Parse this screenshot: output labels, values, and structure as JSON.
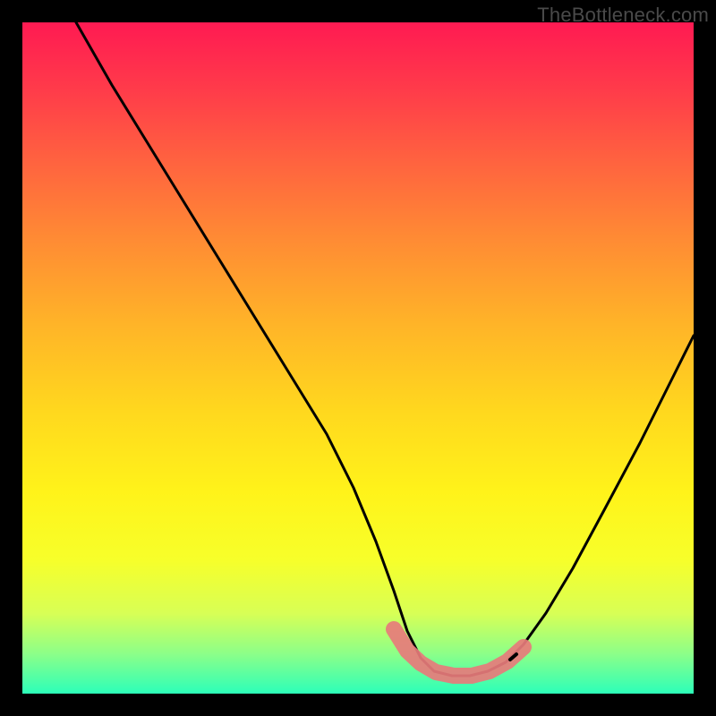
{
  "watermark": "TheBottleneck.com",
  "chart_data": {
    "type": "line",
    "title": "",
    "xlabel": "",
    "ylabel": "",
    "xlim": [
      0,
      100
    ],
    "ylim": [
      0,
      100
    ],
    "series": [
      {
        "name": "bottleneck-curve",
        "x": [
          0,
          5,
          10,
          15,
          20,
          25,
          30,
          35,
          40,
          45,
          50,
          54,
          57,
          60,
          63,
          66,
          70,
          74,
          78,
          82,
          86,
          90,
          95,
          100
        ],
        "y": [
          100,
          92,
          84,
          76,
          67,
          58,
          49,
          40,
          31,
          22,
          13,
          7,
          4,
          3,
          3,
          3,
          4,
          6,
          11,
          18,
          26,
          34,
          44,
          55
        ]
      },
      {
        "name": "sweet-spot-band",
        "x": [
          54,
          57,
          60,
          63,
          66,
          70,
          74
        ],
        "y": [
          7,
          4,
          3,
          3,
          3,
          4,
          6
        ]
      }
    ],
    "colors": {
      "curve": "#000000",
      "band": "#e77b7b",
      "gradient_top": "#ff1a52",
      "gradient_bottom": "#2cffb9"
    }
  }
}
